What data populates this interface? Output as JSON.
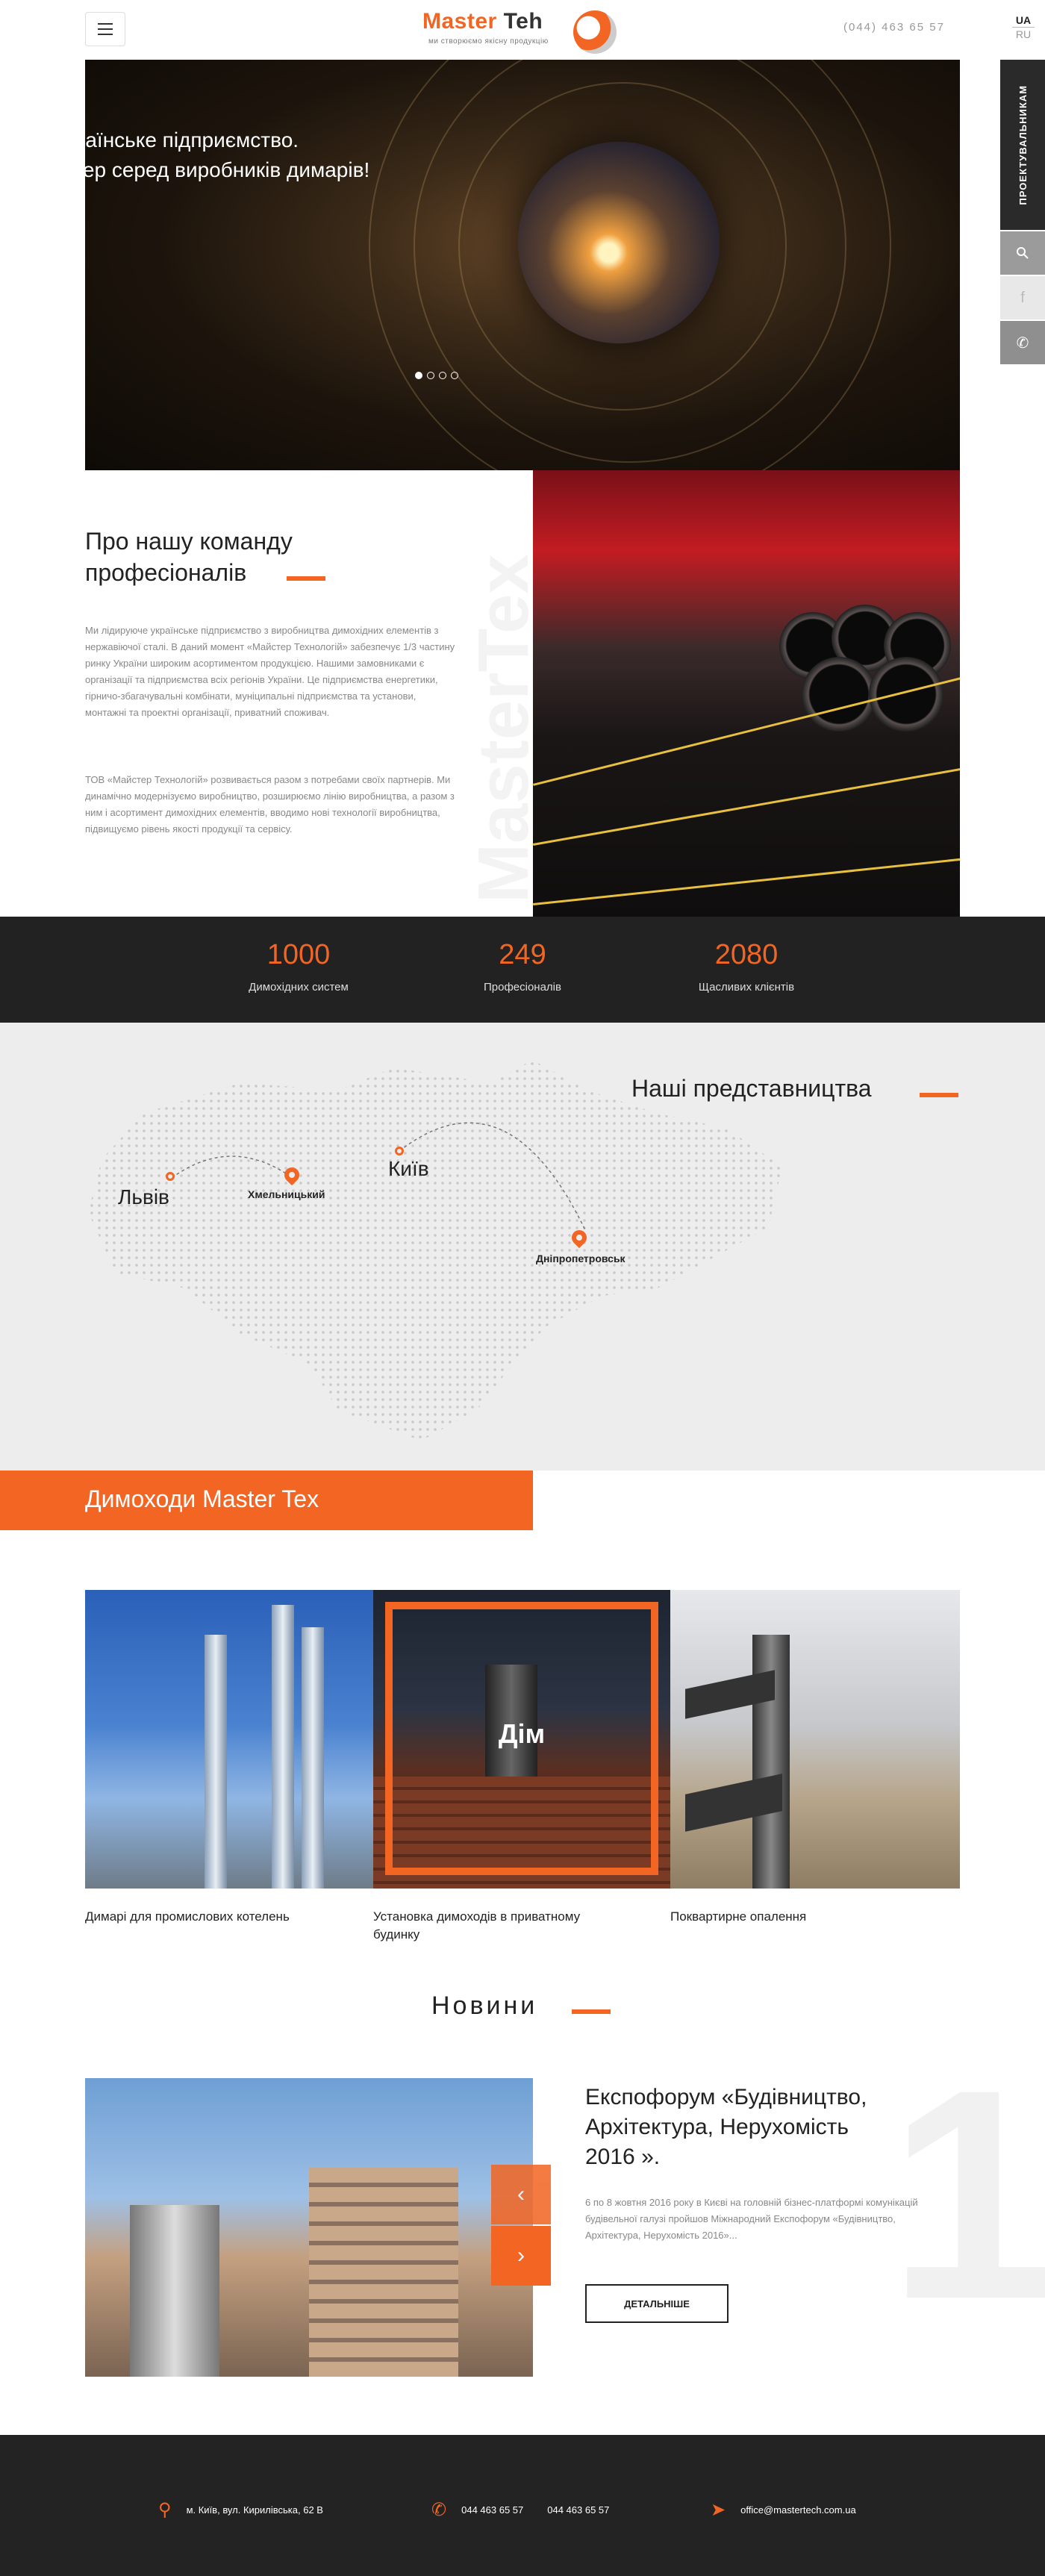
{
  "header": {
    "logo_word_a": "Master",
    "logo_word_b": "Teh",
    "logo_tagline": "ми створюємо якісну продукцію",
    "phone": "(044) 463 65 57",
    "lang_active": "UA",
    "lang_other": "RU"
  },
  "side": {
    "designers_label": "ПРОЕКТУВАЛЬНИКАМ",
    "search_icon": "search-icon",
    "facebook_icon": "facebook-icon",
    "phone_icon": "phone-icon"
  },
  "hero": {
    "title_line1": "Українське підприємство.",
    "title_line2": "Лідер серед виробників димарів!",
    "slides_total": 4,
    "slide_active": 1
  },
  "about": {
    "title": "Про нашу команду професіоналів",
    "paragraph1": "Ми лідируюче українське підприємство з виробництва димохідних елементів з нержавіючої сталі. В даний момент «Майстер Технологій» забезпечує 1/3 частину ринку України широким асортиментом продукцією. Нашими замовниками є організації та підприємства всіх регіонів України. Це підприємства енергетики, гірничо-збагачувальні комбінати, муніципальні підприємства та установи, монтажні та проектні організації, приватний споживач.",
    "paragraph2": "ТОВ «Майстер Технологій» розвивається разом з потребами своїх партнерів. Ми динамічно модернізуємо виробництво, розширюємо лінію виробництва, а разом з ним і асортимент димохідних елементів, вводимо нові технології виробництва, підвищуємо рівень якості продукції та сервісу.",
    "watermark": "MasterTex"
  },
  "stats": [
    {
      "number": "1000",
      "label": "Димохідних систем"
    },
    {
      "number": "249",
      "label": "Професіоналів"
    },
    {
      "number": "2080",
      "label": "Щасливих клієнтів"
    }
  ],
  "map": {
    "title": "Наші представництва",
    "cities": {
      "lviv": "Львів",
      "khmelnytskyi": "Хмельницький",
      "kyiv": "Київ",
      "dnipro": "Дніпропетровськ"
    }
  },
  "chimneys": {
    "title": "Димоходи Master Tex",
    "cards": [
      {
        "caption": "Димарі для промислових котелень"
      },
      {
        "caption": "Установка димоходів в приватному будинку",
        "overlay": "Дім"
      },
      {
        "caption": "Поквартирне опалення"
      }
    ]
  },
  "news": {
    "title": "Новини",
    "headline": "Експофорум «Будівництво, Архітектура, Нерухомість 2016 ».",
    "text": "6 по 8 жовтня 2016 року в Києві на головній бізнес-платформі комунікацій будівельної галузі пройшов Міжнародний Експофорум «Будівництво, Архітектура, Нерухомість 2016»...",
    "button": "ДЕТАЛЬНІШЕ",
    "number": "1",
    "prev_icon": "chevron-left-icon",
    "next_icon": "chevron-right-icon"
  },
  "footer": {
    "address": "м. Київ, вул. Кирилівська, 62 В",
    "phone1": "044 463 65 57",
    "phone2": "044 463 65 57",
    "email": "office@mastertech.com.ua"
  },
  "colors": {
    "accent": "#f26522",
    "dark": "#222222",
    "map_bg": "#ededee"
  }
}
